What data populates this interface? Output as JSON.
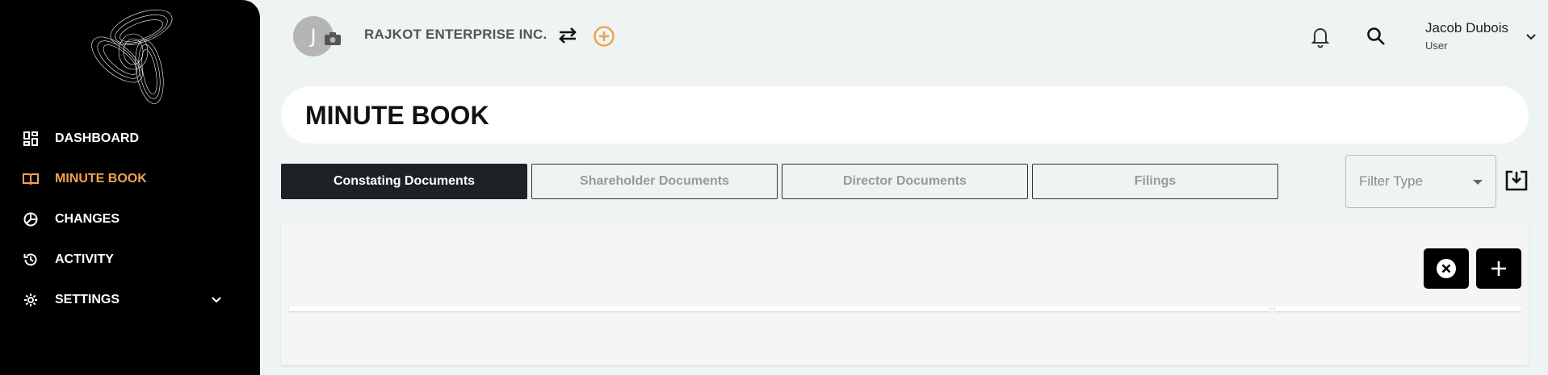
{
  "sidebar": {
    "items": [
      {
        "label": "DASHBOARD",
        "icon": "dashboard-icon"
      },
      {
        "label": "MINUTE BOOK",
        "icon": "book-icon",
        "active": true
      },
      {
        "label": "CHANGES",
        "icon": "changes-icon"
      },
      {
        "label": "ACTIVITY",
        "icon": "history-icon"
      },
      {
        "label": "SETTINGS",
        "icon": "gear-icon"
      }
    ]
  },
  "header": {
    "avatar_initial": "J",
    "company": "RAJKOT ENTERPRISE INC.",
    "user_name": "Jacob Dubois",
    "user_role": "User"
  },
  "page": {
    "title": "MINUTE BOOK"
  },
  "tabs": [
    {
      "label": "Constating Documents",
      "active": true
    },
    {
      "label": "Shareholder Documents"
    },
    {
      "label": "Director Documents"
    },
    {
      "label": "Filings"
    }
  ],
  "filter": {
    "placeholder": "Filter Type"
  },
  "colors": {
    "accent": "#f0a350",
    "sidebar_bg": "#000000",
    "active_tab": "#1d2227"
  }
}
